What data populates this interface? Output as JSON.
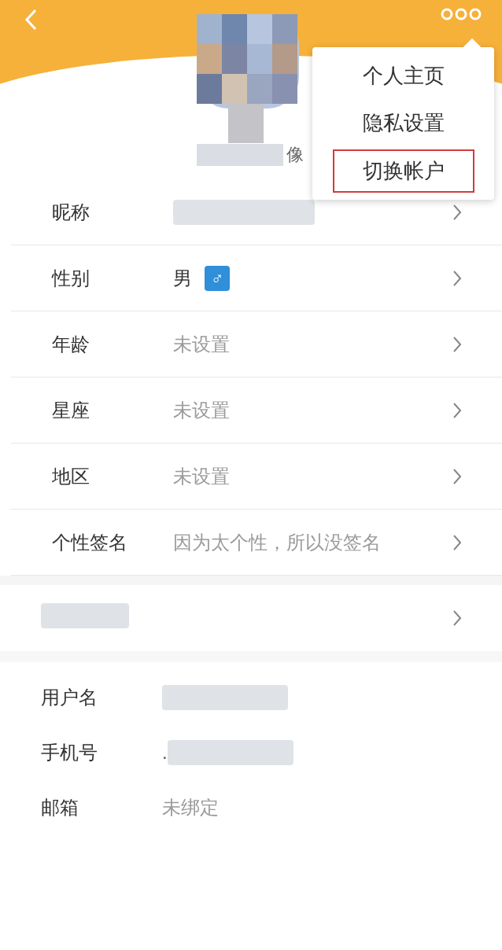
{
  "avatar": {
    "kind": "picture",
    "caption": "像",
    "caption_redacted": true
  },
  "menu": {
    "items": [
      {
        "label": "个人主页",
        "highlighted": false
      },
      {
        "label": "隐私设置",
        "highlighted": false
      },
      {
        "label": "切换帐户",
        "highlighted": true
      }
    ]
  },
  "profile_rows": [
    {
      "kind": "text",
      "label": "昵称",
      "redacted": true
    },
    {
      "kind": "gender",
      "label": "性别",
      "value": "男",
      "symbol": "♂",
      "muted": false
    },
    {
      "kind": "text",
      "label": "年龄",
      "value": "未设置",
      "muted": true
    },
    {
      "kind": "text",
      "label": "星座",
      "value": "未设置",
      "muted": true
    },
    {
      "kind": "text",
      "label": "地区",
      "value": "未设置",
      "muted": true
    },
    {
      "kind": "text",
      "label": "个性签名",
      "value": "因为太个性，所以没签名",
      "muted": true
    }
  ],
  "extra_row": {
    "redacted": true
  },
  "account_rows": [
    {
      "label": "用户名",
      "redacted": true
    },
    {
      "label": "手机号",
      "value": ".",
      "redacted": true
    },
    {
      "label": "邮箱",
      "value": "未绑定",
      "muted": true
    }
  ]
}
